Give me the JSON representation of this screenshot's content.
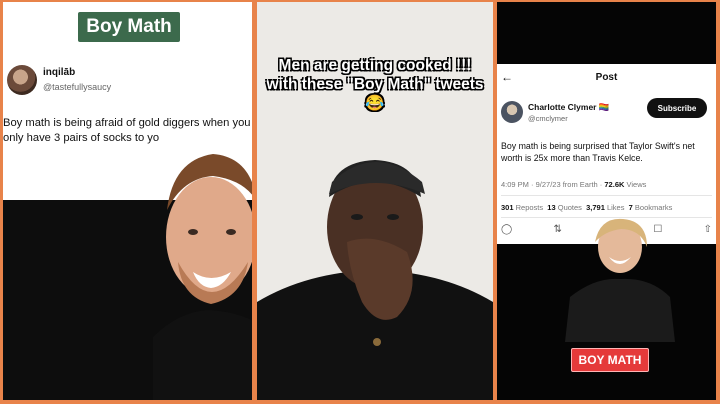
{
  "left_panel": {
    "badge": "Boy Math",
    "tweet": {
      "author_name": "inqilāb",
      "author_handle": "@tastefullysaucy",
      "text": "Boy math is being afraid of gold diggers when you only have 3 pairs of socks to yo"
    }
  },
  "center_panel": {
    "caption": "Men are getting cooked !!! with these \"Boy Math\" tweets 😂"
  },
  "right_panel": {
    "header": {
      "back_icon": "back-arrow-icon",
      "title": "Post"
    },
    "tweet": {
      "author_name": "Charlotte Clymer 🏳️‍🌈",
      "author_handle": "@cmclymer",
      "subscribe_label": "Subscribe",
      "text": "Boy math is being surprised that Taylor Swift's net worth is 25x more than Travis Kelce.",
      "timestamp": "4:09 PM · 9/27/23 from Earth ·",
      "views_count": "72.6K",
      "views_label": "Views",
      "reposts_count": "301",
      "reposts_label": "Reposts",
      "quotes_count": "13",
      "quotes_label": "Quotes",
      "likes_count": "3,791",
      "likes_label": "Likes",
      "bookmarks_count": "7",
      "bookmarks_label": "Bookmarks",
      "actions": [
        "reply-icon",
        "repost-icon",
        "like-icon",
        "bookmark-icon",
        "share-icon"
      ]
    },
    "tag": "BOY MATH"
  },
  "colors": {
    "frame": "#e8834a",
    "badge_green": "#3c6a4c",
    "tag_red": "#e53a3a"
  }
}
